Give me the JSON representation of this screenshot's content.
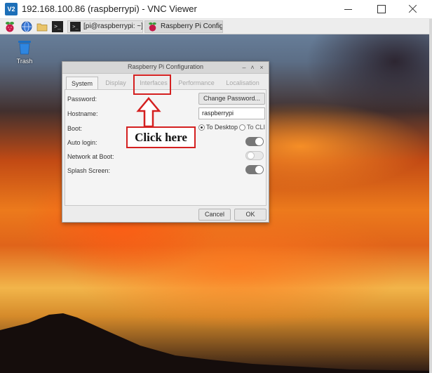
{
  "window": {
    "title": "192.168.100.86 (raspberrypi) - VNC Viewer",
    "logo_text": "V2"
  },
  "taskbar": {
    "tasks": [
      {
        "label": "[pi@raspberrypi: ~]"
      },
      {
        "label": "Raspberry Pi Configu..."
      }
    ]
  },
  "desktop": {
    "trash_label": "Trash"
  },
  "dialog": {
    "title": "Raspberry Pi Configuration",
    "tabs": [
      {
        "label": "System",
        "active": true
      },
      {
        "label": "Display",
        "active": false
      },
      {
        "label": "Interfaces",
        "active": false
      },
      {
        "label": "Performance",
        "active": false
      },
      {
        "label": "Localisation",
        "active": false
      }
    ],
    "rows": {
      "password_label": "Password:",
      "change_password_label": "Change Password...",
      "hostname_label": "Hostname:",
      "hostname_value": "raspberrypi",
      "boot_label": "Boot:",
      "boot_desktop": "To Desktop",
      "boot_cli": "To CLI",
      "boot_selected": "To Desktop",
      "autologin_label": "Auto login:",
      "autologin_on": true,
      "network_label": "Network at Boot:",
      "network_on": false,
      "splash_label": "Splash Screen:",
      "splash_on": true
    },
    "buttons": {
      "cancel": "Cancel",
      "ok": "OK"
    }
  },
  "annotation": {
    "callout_text": "Click here",
    "color": "#d42020"
  }
}
